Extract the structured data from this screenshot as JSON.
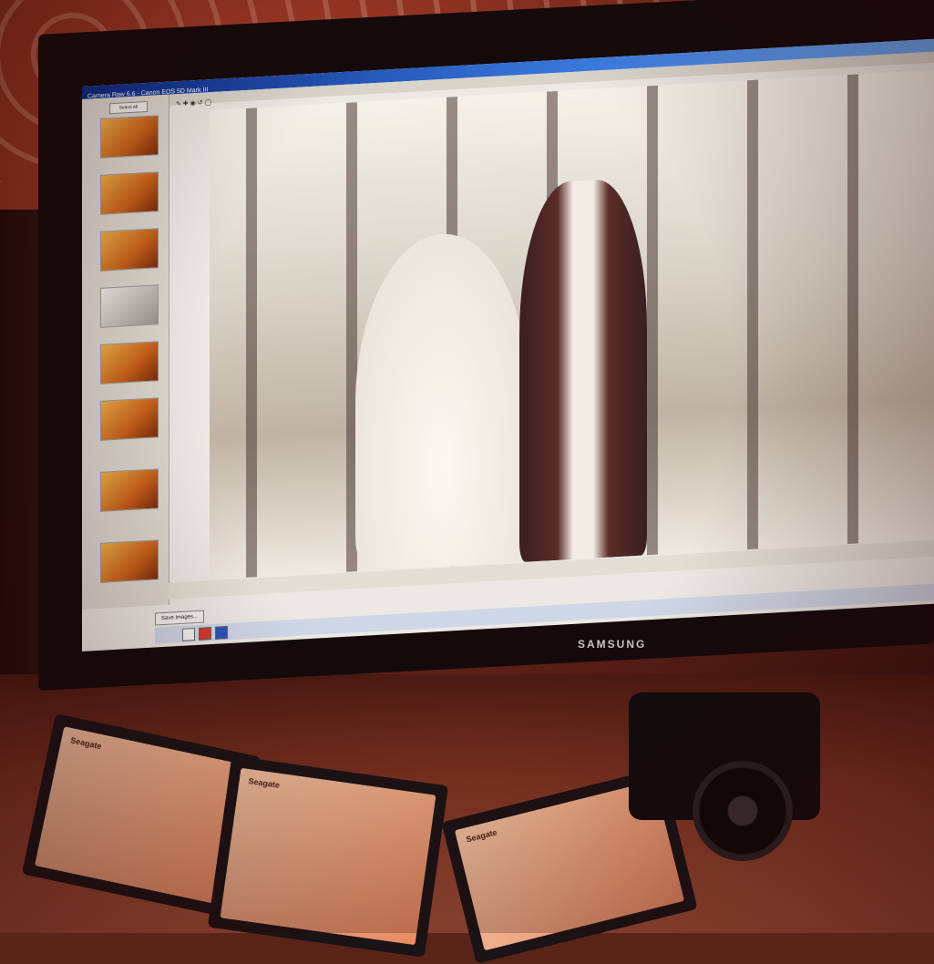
{
  "app": {
    "window_title": "Camera Raw 6.6 - Canon EOS 5D Mark III",
    "select_all_label": "Select All",
    "save_images_label": "Save Images...",
    "toolbar_hint": "",
    "filename": "",
    "status_text": ""
  },
  "filmstrip": {
    "thumbnails": [
      {
        "tone": "warm",
        "caption": ""
      },
      {
        "tone": "warm",
        "caption": ""
      },
      {
        "tone": "warm",
        "caption": ""
      },
      {
        "tone": "bw",
        "caption": ""
      },
      {
        "tone": "warm",
        "caption": ""
      },
      {
        "tone": "warm",
        "caption": ""
      },
      {
        "tone": "warm",
        "caption": ""
      },
      {
        "tone": "warm",
        "caption": ""
      }
    ]
  },
  "monitor": {
    "brand": "SAMSUNG"
  },
  "drives": [
    {
      "label": "Seagate"
    },
    {
      "label": "Seagate"
    },
    {
      "label": "Seagate"
    }
  ],
  "colors": {
    "wall": "#7a2a1c",
    "titlebar": "#0a2b86",
    "photo_tone": "#f5f1ea"
  }
}
